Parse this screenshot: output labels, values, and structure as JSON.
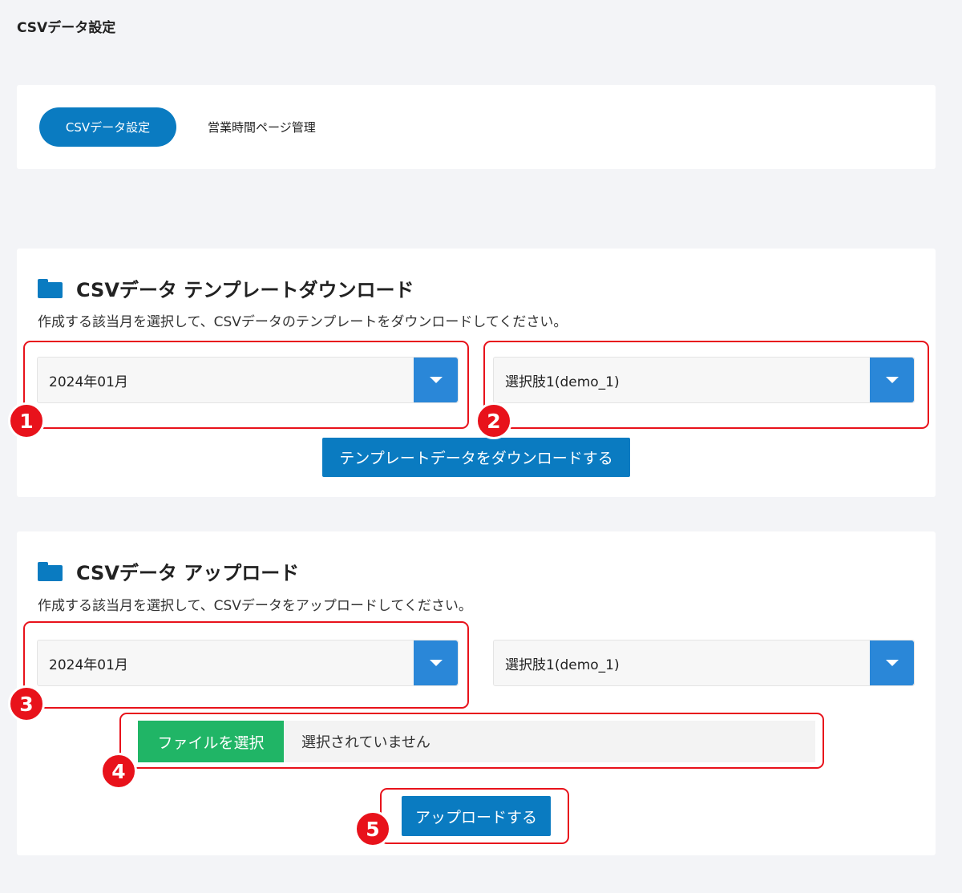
{
  "page_title": "CSVデータ設定",
  "tabs": [
    {
      "label": "CSVデータ設定",
      "active": true
    },
    {
      "label": "営業時間ページ管理",
      "active": false
    }
  ],
  "download": {
    "title": "CSVデータ テンプレートダウンロード",
    "description": "作成する該当月を選択して、CSVデータのテンプレートをダウンロードしてください。",
    "month_select": "2024年01月",
    "option_select": "選択肢1(demo_1)",
    "button_label": "テンプレートデータをダウンロードする"
  },
  "upload": {
    "title": "CSVデータ アップロード",
    "description": "作成する該当月を選択して、CSVデータをアップロードしてください。",
    "month_select": "2024年01月",
    "option_select": "選択肢1(demo_1)",
    "file_button_label": "ファイルを選択",
    "file_status": "選択されていません",
    "button_label": "アップロードする"
  },
  "annotations": [
    "1",
    "2",
    "3",
    "4",
    "5"
  ],
  "colors": {
    "accent": "#0a7bc1",
    "select_arrow": "#2a87d8",
    "file_button": "#20b566",
    "highlight": "#e8121b",
    "background": "#f3f4f7"
  },
  "icons": [
    "folder-icon",
    "chevron-down-icon"
  ]
}
